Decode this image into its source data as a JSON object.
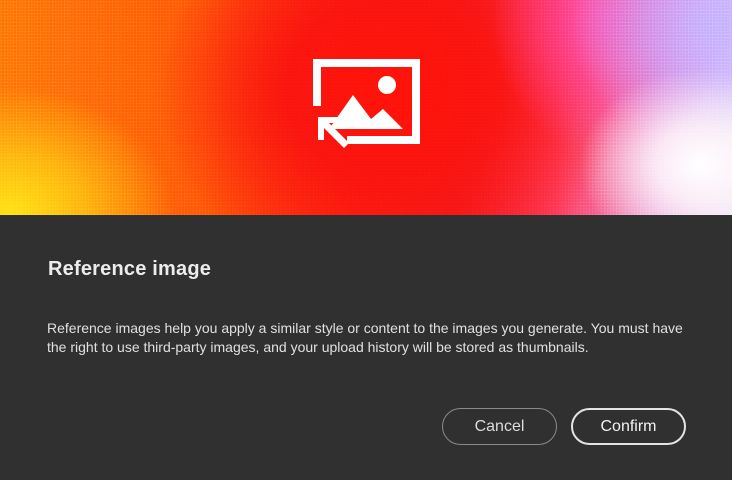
{
  "dialog": {
    "hero_icon": "reference-image-upload-icon",
    "title": "Reference image",
    "description": "Reference images help you apply a similar style or content to the images you generate. You must have the right to use third-party images, and your upload history will be stored as thumbnails.",
    "buttons": {
      "cancel_label": "Cancel",
      "confirm_label": "Confirm"
    }
  },
  "colors": {
    "background": "#303030",
    "text": "#e6e6e6",
    "hero_orange": "#ff7a0c",
    "hero_red": "#ff1208",
    "hero_yellow": "#ffe318",
    "hero_violet": "#c7b4ff"
  }
}
